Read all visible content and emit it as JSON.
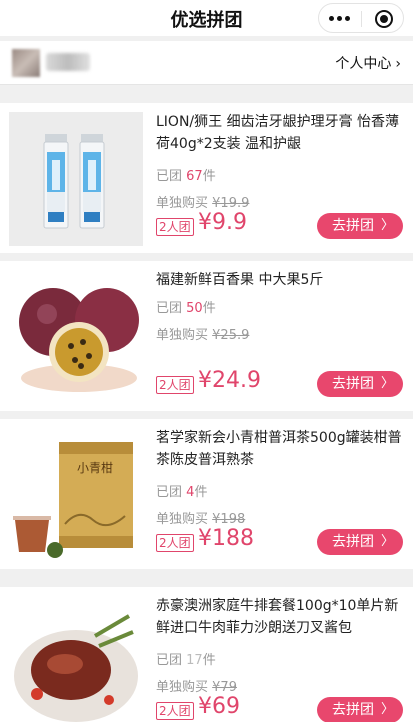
{
  "nav": {
    "title": "优选拼团",
    "menu_icon": "more-dots-icon",
    "close_icon": "target-circle-icon"
  },
  "user": {
    "center_label": "个人中心",
    "chevron": "›"
  },
  "products": [
    {
      "title": "LION/狮王 细齿洁牙龈护理牙膏 怡香薄荷40g*2支装 温和护龈",
      "sold_prefix": "已团",
      "sold_count": "67",
      "sold_unit": "件",
      "solo_label": "单独购买",
      "solo_price": "¥19.9",
      "group_badge": "2人团",
      "price": "¥9.9",
      "button": "去拼团",
      "image": "toothpaste-image"
    },
    {
      "title": "福建新鲜百香果 中大果5斤",
      "sold_prefix": "已团",
      "sold_count": "50",
      "sold_unit": "件",
      "solo_label": "单独购买",
      "solo_price": "¥25.9",
      "group_badge": "2人团",
      "price": "¥24.9",
      "button": "去拼团",
      "image": "passion-fruit-image"
    },
    {
      "title": "茗学家新会小青柑普洱茶500g罐装柑普茶陈皮普洱熟茶",
      "sold_prefix": "已团",
      "sold_count": "4",
      "sold_unit": "件",
      "solo_label": "单独购买",
      "solo_price": "¥198",
      "group_badge": "2人团",
      "price": "¥188",
      "button": "去拼团",
      "image": "tea-can-image",
      "can_text": "小青柑"
    },
    {
      "title": "赤豪澳洲家庭牛排套餐100g*10单片新鲜进口牛肉菲力沙朗送刀叉酱包",
      "sold_prefix": "已团",
      "sold_count": "17",
      "sold_unit": "件",
      "solo_label": "单独购买",
      "solo_price": "¥79",
      "group_badge": "2人团",
      "price": "¥69",
      "button": "去拼团",
      "image": "steak-image"
    }
  ],
  "colors": {
    "accent": "#e8476d",
    "price": "#e0456b",
    "muted": "#999999"
  }
}
